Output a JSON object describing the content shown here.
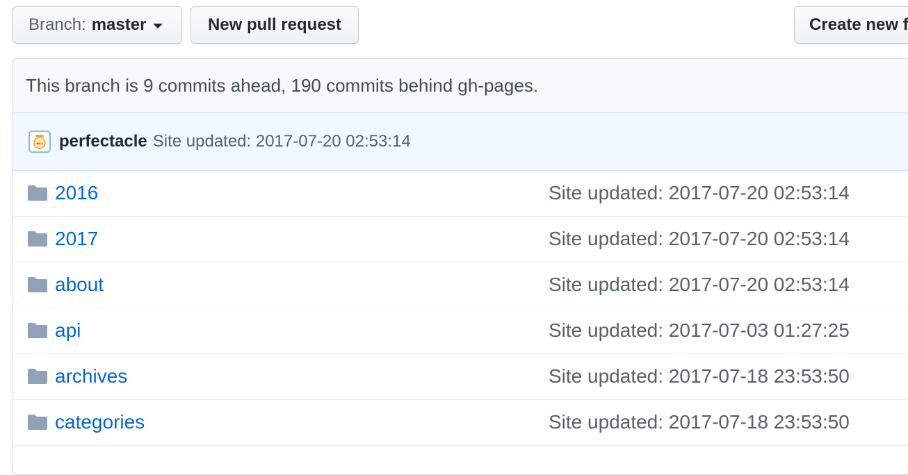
{
  "toolbar": {
    "branch_prefix": "Branch:",
    "branch_name": "master",
    "new_pr_label": "New pull request",
    "create_new_label": "Create new file"
  },
  "branch_status": "This branch is 9 commits ahead, 190 commits behind gh-pages.",
  "latest_commit": {
    "author": "perfectacle",
    "message": "Site updated: 2017-07-20 02:53:14"
  },
  "files": [
    {
      "name": "2016",
      "message": "Site updated: 2017-07-20 02:53:14",
      "icon": "folder-icon"
    },
    {
      "name": "2017",
      "message": "Site updated: 2017-07-20 02:53:14",
      "icon": "folder-icon"
    },
    {
      "name": "about",
      "message": "Site updated: 2017-07-20 02:53:14",
      "icon": "folder-icon"
    },
    {
      "name": "api",
      "message": "Site updated: 2017-07-03 01:27:25",
      "icon": "folder-icon"
    },
    {
      "name": "archives",
      "message": "Site updated: 2017-07-18 23:53:50",
      "icon": "folder-icon"
    },
    {
      "name": "categories",
      "message": "Site updated: 2017-07-18 23:53:50",
      "icon": "folder-icon"
    }
  ],
  "colors": {
    "link": "#0366d6",
    "folder": "#8fa2b7",
    "commit_bar_bg": "#f1f8ff",
    "branch_info_bg": "#f6f8fa"
  }
}
